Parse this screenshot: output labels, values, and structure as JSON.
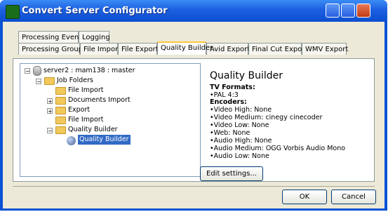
{
  "window": {
    "title": "Convert Server Configurator"
  },
  "tabs_row1": [
    "Processing Events",
    "Logging"
  ],
  "tabs_row2": [
    "Processing Groups",
    "File Import",
    "File Export",
    "Quality Builder",
    "Avid Export",
    "Final Cut Export",
    "WMV Export"
  ],
  "active_tab": "Quality Builder",
  "tree": {
    "root": "server2 : mam138 : master",
    "job_folders": "Job Folders",
    "items": [
      "File Import",
      "Documents Import",
      "Export",
      "File Import",
      "Quality Builder"
    ],
    "selected": "Quality Builder"
  },
  "details": {
    "heading": "Quality Builder",
    "tv_formats_label": "TV Formats:",
    "tv_formats": "•PAL 4:3",
    "encoders_label": "Encoders:",
    "encoders": [
      "•Video High: None",
      "•Video Medium: cinegy cinecoder",
      "•Video Low: None",
      "•Web: None",
      "•Audio High: None",
      "•Audio Medium: OGG Vorbis Audio Mono",
      "•Audio Low: None"
    ],
    "edit_button": "Edit settings..."
  },
  "buttons": {
    "ok": "OK",
    "cancel": "Cancel"
  }
}
